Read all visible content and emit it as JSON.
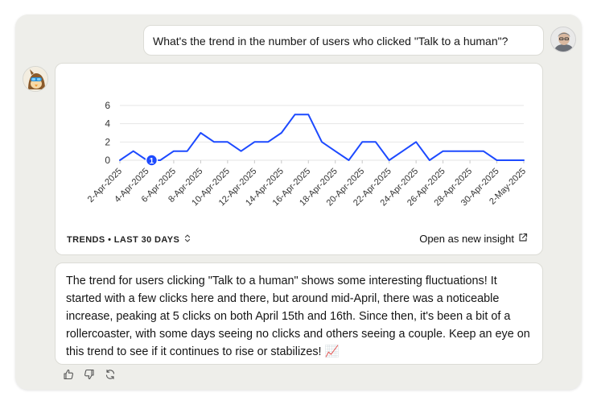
{
  "user_message": "What's the trend in the number of users who clicked \"Talk to a human\"?",
  "chart_footer": {
    "range_label": "TRENDS • LAST 30 DAYS",
    "open_insight_label": "Open as new insight"
  },
  "answer": {
    "text": "The trend for users clicking \"Talk to a human\" shows some interesting fluctuations! It started with a few clicks here and there, but around mid-April, there was a noticeable increase, peaking at 5 clicks on both April 15th and 16th. Since then, it's been a bit of a rollercoaster, with some days seeing no clicks and others seeing a couple. Keep an eye on this trend to see if it continues to rise or stabilizes!",
    "emoji": "📈"
  },
  "icons": [
    "thumbs-up-icon",
    "thumbs-down-icon",
    "retry-icon",
    "chevron-updown-icon",
    "external-link-icon"
  ],
  "colors": {
    "line": "#1d4aff",
    "panel": "#eeeeea",
    "grid": "#e6e6e6"
  },
  "chart_data": {
    "type": "line",
    "title": "",
    "xlabel": "",
    "ylabel": "",
    "ylim": [
      0,
      6
    ],
    "yticks": [
      0,
      2,
      4,
      6
    ],
    "grid": true,
    "x": [
      "2-Apr-2025",
      "3-Apr-2025",
      "4-Apr-2025",
      "5-Apr-2025",
      "6-Apr-2025",
      "7-Apr-2025",
      "8-Apr-2025",
      "9-Apr-2025",
      "10-Apr-2025",
      "11-Apr-2025",
      "12-Apr-2025",
      "13-Apr-2025",
      "14-Apr-2025",
      "15-Apr-2025",
      "16-Apr-2025",
      "17-Apr-2025",
      "18-Apr-2025",
      "19-Apr-2025",
      "20-Apr-2025",
      "21-Apr-2025",
      "22-Apr-2025",
      "23-Apr-2025",
      "24-Apr-2025",
      "25-Apr-2025",
      "26-Apr-2025",
      "27-Apr-2025",
      "28-Apr-2025",
      "29-Apr-2025",
      "30-Apr-2025",
      "1-May-2025",
      "2-May-2025"
    ],
    "xticks": [
      "2-Apr-2025",
      "4-Apr-2025",
      "6-Apr-2025",
      "8-Apr-2025",
      "10-Apr-2025",
      "12-Apr-2025",
      "14-Apr-2025",
      "16-Apr-2025",
      "18-Apr-2025",
      "20-Apr-2025",
      "22-Apr-2025",
      "24-Apr-2025",
      "26-Apr-2025",
      "28-Apr-2025",
      "30-Apr-2025",
      "2-May-2025"
    ],
    "series": [
      {
        "values": [
          0,
          1,
          0,
          0,
          1,
          1,
          3,
          2,
          2,
          1,
          2,
          2,
          3,
          5,
          5,
          2,
          1,
          0,
          2,
          2,
          0,
          1,
          2,
          0,
          1,
          1,
          1,
          1,
          0,
          0,
          0
        ]
      }
    ],
    "annotations": [
      {
        "x": "4-Apr-2025",
        "label": "1"
      }
    ]
  }
}
